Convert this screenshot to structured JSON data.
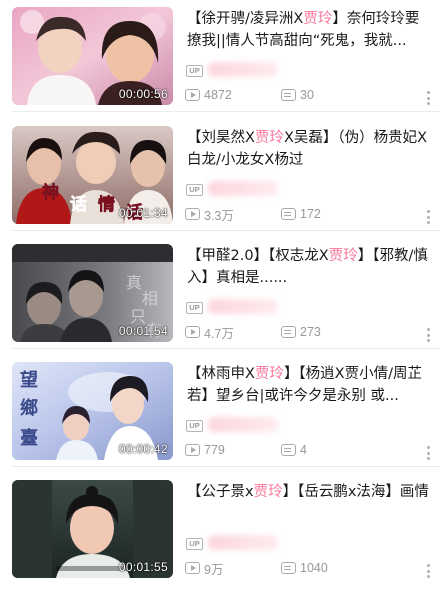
{
  "items": [
    {
      "title": [
        {
          "text": "【徐开骋/凌异洲X",
          "hl": false
        },
        {
          "text": "贾玲",
          "hl": true
        },
        {
          "text": "】奈何玲玲要撩我||情人节高甜向“死鬼，我就...",
          "hl": false
        }
      ],
      "duration": "00:00:56",
      "up_badge": "UP",
      "play_count": "4872",
      "danmaku_count": "30"
    },
    {
      "title": [
        {
          "text": "【刘昊然X",
          "hl": false
        },
        {
          "text": "贾玲",
          "hl": true
        },
        {
          "text": "X吴磊】（伪）杨贵妃X白龙/小龙女X杨过",
          "hl": false
        }
      ],
      "duration": "00:01:34",
      "up_badge": "UP",
      "play_count": "3.3万",
      "danmaku_count": "172"
    },
    {
      "title": [
        {
          "text": "【甲醛2.0】【权志龙X",
          "hl": false
        },
        {
          "text": "贾玲",
          "hl": true
        },
        {
          "text": "】【邪教/慎入】真相是......",
          "hl": false
        }
      ],
      "duration": "00:01:54",
      "up_badge": "UP",
      "play_count": "4.7万",
      "danmaku_count": "273"
    },
    {
      "title": [
        {
          "text": "【林雨申X",
          "hl": false
        },
        {
          "text": "贾玲",
          "hl": true
        },
        {
          "text": "】【杨逍X贾小倩/周芷若】望乡台|或许今夕是永别 或...",
          "hl": false
        }
      ],
      "duration": "00:00:42",
      "up_badge": "UP",
      "play_count": "779",
      "danmaku_count": "4"
    },
    {
      "title": [
        {
          "text": "【公子景x",
          "hl": false
        },
        {
          "text": "贾玲",
          "hl": true
        },
        {
          "text": "】【岳云鹏x法海】画情",
          "hl": false
        }
      ],
      "duration": "00:01:55",
      "up_badge": "UP",
      "play_count": "9万",
      "danmaku_count": "1040"
    }
  ],
  "colors": {
    "highlight": "#fb7299",
    "meta_text": "#999999",
    "title_text": "#1a1a1a",
    "divider": "#ececec"
  },
  "icons": {
    "play": "play-count-icon",
    "danmaku": "danmaku-count-icon",
    "more": "more-vertical-icon"
  }
}
